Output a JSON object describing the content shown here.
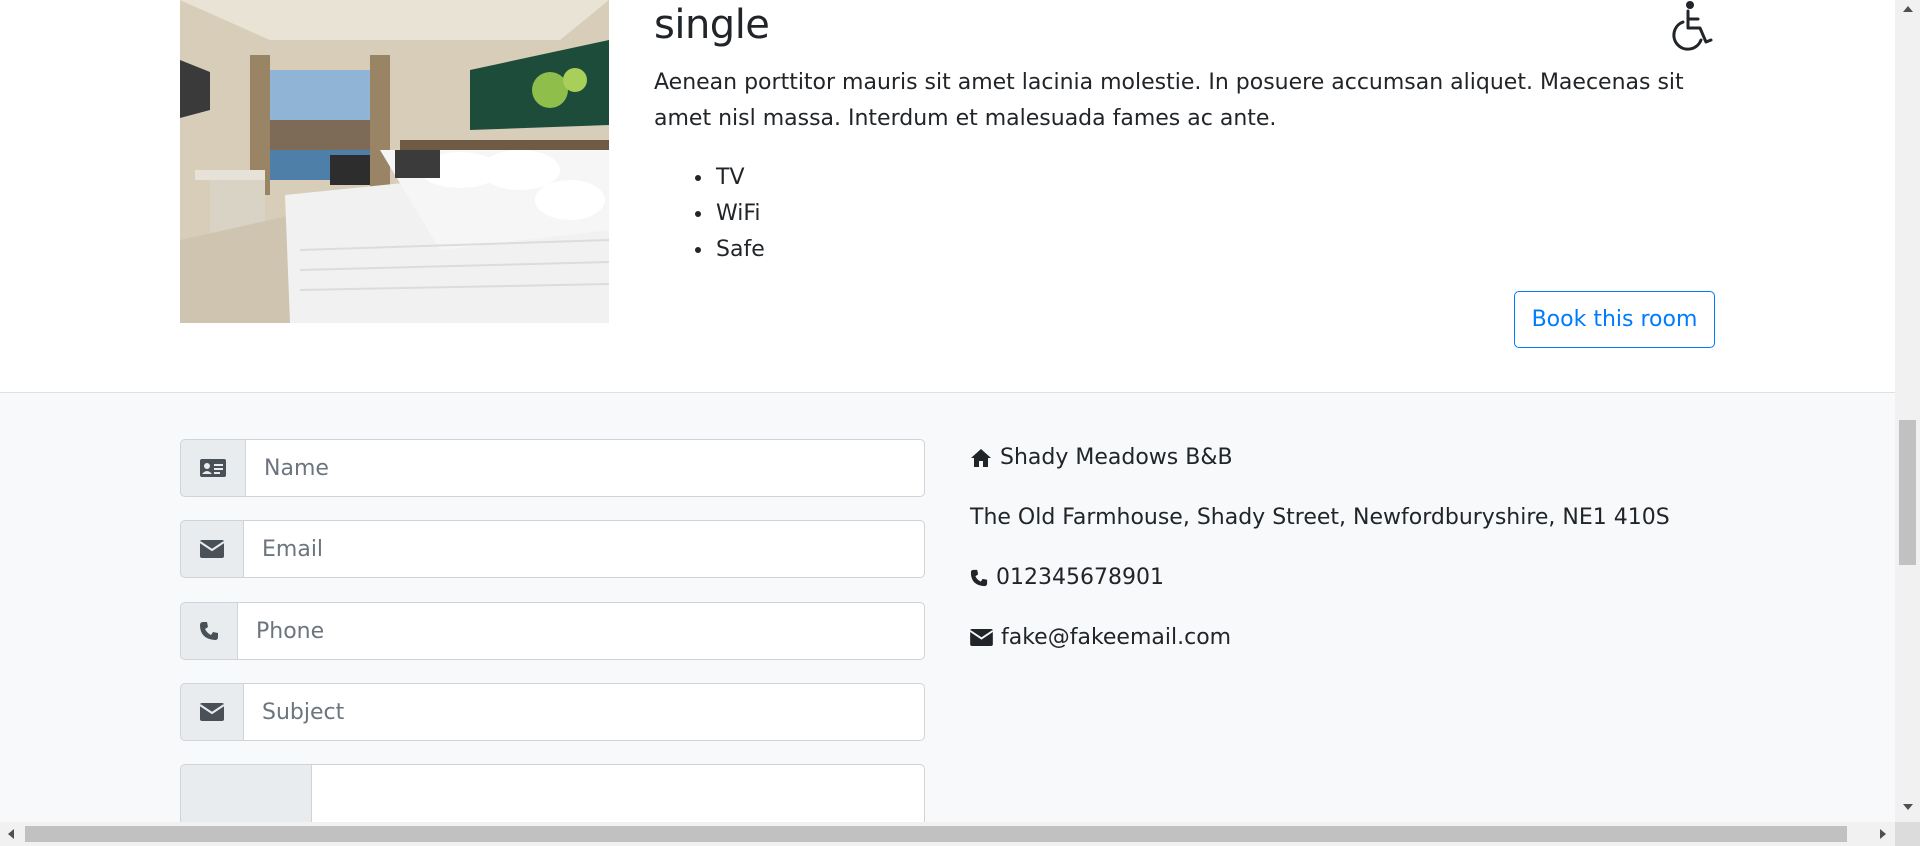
{
  "room": {
    "title": "single",
    "description": "Aenean porttitor mauris sit amet lacinia molestie. In posuere accumsan aliquet. Maecenas sit amet nisl massa. Interdum et malesuada fames ac ante.",
    "features": [
      "TV",
      "WiFi",
      "Safe"
    ],
    "book_label": "Book this room",
    "accessible_icon": "wheelchair-icon",
    "accent_color": "#007bff"
  },
  "contact_form": {
    "name_placeholder": "Name",
    "email_placeholder": "Email",
    "phone_placeholder": "Phone",
    "subject_placeholder": "Subject",
    "icons": [
      "id-card-icon",
      "envelope-icon",
      "phone-icon",
      "envelope-icon",
      "message-icon"
    ]
  },
  "contact_info": {
    "business_name": "Shady Meadows B&B",
    "address": "The Old Farmhouse, Shady Street, Newfordburyshire, NE1 410S",
    "phone": "012345678901",
    "email": "fake@fakeemail.com",
    "icons": [
      "home-icon",
      "phone-icon",
      "envelope-icon"
    ]
  },
  "colors": {
    "section_background": "#f7f9fb",
    "input_addon": "#e9ecef",
    "text": "#212529"
  }
}
